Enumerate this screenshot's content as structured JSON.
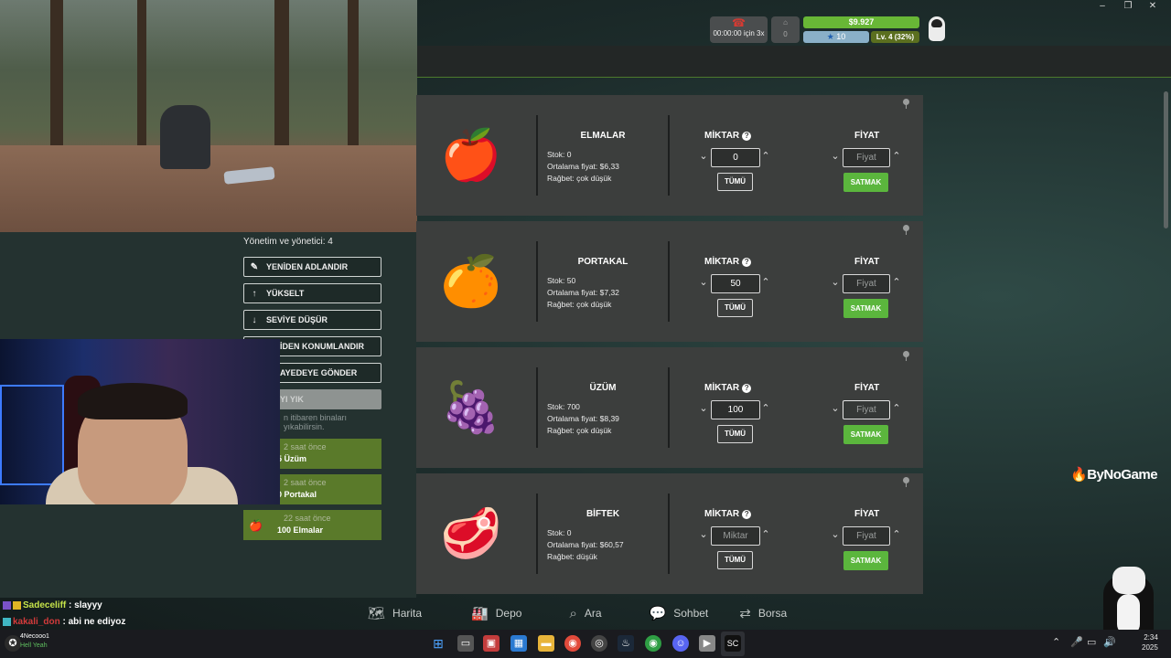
{
  "hud": {
    "timer": "00:00:00 için 3x",
    "money": "$9.927",
    "stars": "10",
    "level": "Lv. 4 (32%)"
  },
  "management": {
    "title": "Yönetim ve yönetici: 4",
    "buttons": [
      {
        "label": "YENİDEN ADLANDIR",
        "icon": "✎"
      },
      {
        "label": "YÜKSELT",
        "icon": "↑"
      },
      {
        "label": "SEVİYE DÜŞÜR",
        "icon": "↓"
      },
      {
        "label": "İDEN KONUMLANDIR",
        "icon": ""
      },
      {
        "label": "AYEDEYE GÖNDER",
        "icon": ""
      },
      {
        "label": "YI YIK",
        "icon": ""
      }
    ],
    "note": "n itibaren binaları yıkabilirsin.",
    "history": [
      {
        "ago": "2 saat önce",
        "what": "5 Üzüm"
      },
      {
        "ago": "2 saat önce",
        "what": "0 Portakal"
      },
      {
        "ago": "22 saat önce",
        "what": "100 Elmalar"
      }
    ]
  },
  "market": {
    "items": [
      {
        "name": "ELMALAR",
        "stock": "Stok: 0",
        "avg": "Ortalama fiyat: $6,33",
        "demand": "Rağbet: çok düşük",
        "qty": "0",
        "price_ph": "Fiyat",
        "fruit": "🍎"
      },
      {
        "name": "PORTAKAL",
        "stock": "Stok: 50",
        "avg": "Ortalama fiyat: $7,32",
        "demand": "Rağbet: çok düşük",
        "qty": "50",
        "price_ph": "Fiyat",
        "fruit": "🍊"
      },
      {
        "name": "ÜZÜM",
        "stock": "Stok: 700",
        "avg": "Ortalama fiyat: $8,39",
        "demand": "Rağbet: çok düşük",
        "qty": "100",
        "price_ph": "Fiyat",
        "fruit": "🍇"
      },
      {
        "name": "BİFTEK",
        "stock": "Stok: 0",
        "avg": "Ortalama fiyat: $60,57",
        "demand": "Rağbet: düşük",
        "qty": "Miktar",
        "price_ph": "Fiyat",
        "fruit": "🥩"
      }
    ],
    "qty_label": "MİKTAR",
    "price_label": "FİYAT",
    "all_label": "TÜMÜ",
    "sell_label": "SATMAK"
  },
  "brand": "ByNoGame",
  "nav": [
    {
      "label": "Harita",
      "icon": "map-icon",
      "glyph": "🗺"
    },
    {
      "label": "Depo",
      "icon": "warehouse-icon",
      "glyph": "🏭"
    },
    {
      "label": "Ara",
      "icon": "search-icon",
      "glyph": "⌕"
    },
    {
      "label": "Sohbet",
      "icon": "chat-icon",
      "glyph": "💬"
    },
    {
      "label": "Borsa",
      "icon": "exchange-icon",
      "glyph": "⇄"
    }
  ],
  "chat": [
    {
      "user": "Sadeceliff",
      "msg": ": slayyy"
    },
    {
      "user": "kakali_don",
      "msg": ": abi ne ediyoz"
    }
  ],
  "stream_user": {
    "name": "4Necooo1",
    "sub": "Hell Yeah"
  },
  "clock": {
    "time": "2:34",
    "date": "2025"
  }
}
